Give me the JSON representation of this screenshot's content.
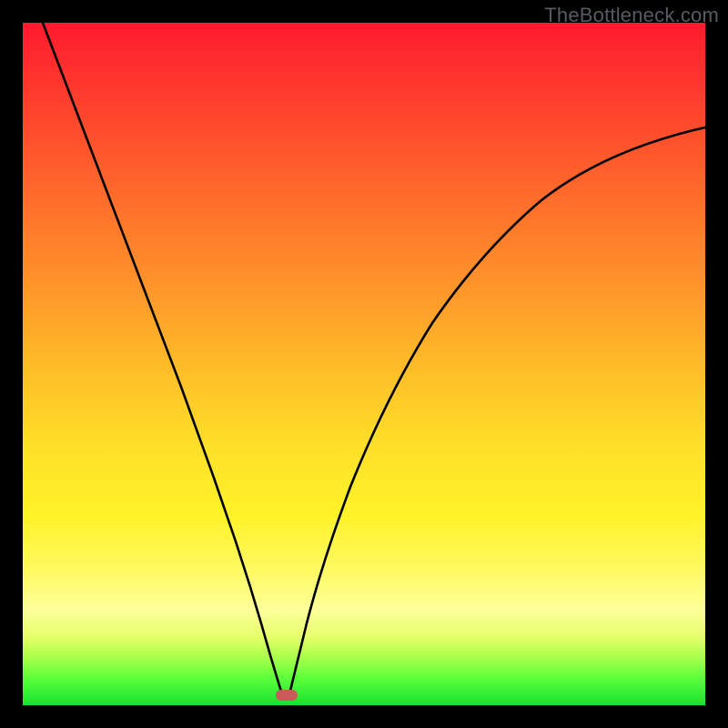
{
  "watermark": "TheBottleneck.com",
  "chart_data": {
    "type": "line",
    "title": "",
    "xlabel": "",
    "ylabel": "",
    "xlim": [
      0,
      100
    ],
    "ylim": [
      0,
      100
    ],
    "notch_x": 33,
    "series": [
      {
        "name": "left-branch",
        "x": [
          3,
          6,
          9,
          12,
          15,
          18,
          21,
          24,
          27,
          30,
          32,
          33
        ],
        "y": [
          100,
          90,
          80,
          70,
          60,
          50,
          40,
          30,
          20,
          10,
          3,
          0
        ]
      },
      {
        "name": "right-branch",
        "x": [
          33,
          34,
          36,
          39,
          43,
          48,
          54,
          61,
          69,
          78,
          88,
          100
        ],
        "y": [
          0,
          3,
          10,
          20,
          30,
          40,
          50,
          60,
          68,
          75,
          80,
          83
        ]
      }
    ],
    "marker": {
      "name": "notch-marker",
      "x": 33,
      "y": 1.5,
      "color": "#cd5a5a"
    },
    "gradient_stops": [
      {
        "pos": 0,
        "color": "#ff1a2e"
      },
      {
        "pos": 25,
        "color": "#ff6a2b"
      },
      {
        "pos": 50,
        "color": "#ffbb28"
      },
      {
        "pos": 75,
        "color": "#fff555"
      },
      {
        "pos": 90,
        "color": "#d8ff5a"
      },
      {
        "pos": 100,
        "color": "#16e330"
      }
    ]
  }
}
